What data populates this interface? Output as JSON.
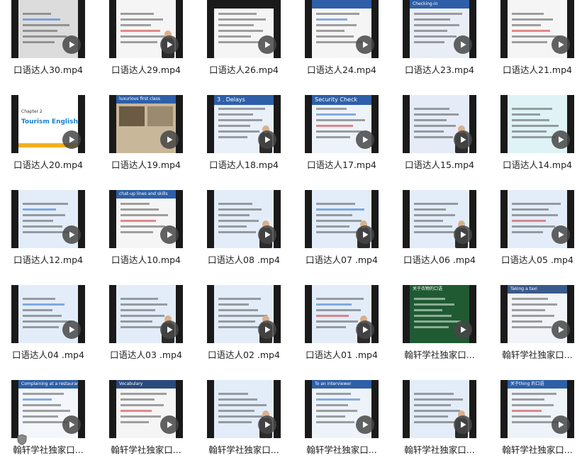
{
  "files": [
    {
      "name": "口语达人30.mp4",
      "theme": "light-gray",
      "accent": "#d9d9d9"
    },
    {
      "name": "口语达人29.mp4",
      "theme": "white",
      "accent": "#e8e8f0"
    },
    {
      "name": "口语达人26.mp4",
      "theme": "white",
      "accent": "#ffffff"
    },
    {
      "name": "口语达人24.mp4",
      "theme": "white",
      "accent": "#ffffff"
    },
    {
      "name": "口语达人23.mp4",
      "theme": "blue",
      "accent": "#2e5fa8"
    },
    {
      "name": "口语达人21.mp4",
      "theme": "white",
      "accent": "#ffffff"
    },
    {
      "name": "口语达人20.mp4",
      "theme": "tourism",
      "accent": "#2a8fd6"
    },
    {
      "name": "口语达人19.mp4",
      "theme": "photo",
      "accent": "#8b7355"
    },
    {
      "name": "口语达人18.mp4",
      "theme": "delays",
      "accent": "#4a7cc7"
    },
    {
      "name": "口语达人17.mp4",
      "theme": "security",
      "accent": "#3a6fb5"
    },
    {
      "name": "口语达人15.mp4",
      "theme": "teacher",
      "accent": "#b9c9e8"
    },
    {
      "name": "口语达人14.mp4",
      "theme": "cyan",
      "accent": "#bfe6ee"
    },
    {
      "name": "口语达人12.mp4",
      "theme": "blue-light",
      "accent": "#cfe0f5"
    },
    {
      "name": "口语达人10.mp4",
      "theme": "white",
      "accent": "#ffffff"
    },
    {
      "name": "口语达人08 .mp4",
      "theme": "blue-light",
      "accent": "#cfe0f5"
    },
    {
      "name": "口语达人07 .mp4",
      "theme": "blue-light",
      "accent": "#cfe0f5"
    },
    {
      "name": "口语达人06 .mp4",
      "theme": "blue-light",
      "accent": "#cfe0f5"
    },
    {
      "name": "口语达人05 .mp4",
      "theme": "blue-light",
      "accent": "#cfe0f5"
    },
    {
      "name": "口语达人04 .mp4",
      "theme": "blue-light",
      "accent": "#cfe0f5"
    },
    {
      "name": "口语达人03 .mp4",
      "theme": "blue-light",
      "accent": "#cfe0f5"
    },
    {
      "name": "口语达人02 .mp4",
      "theme": "blue-light",
      "accent": "#cfe0f5"
    },
    {
      "name": "口语达人01 .mp4",
      "theme": "blue-light",
      "accent": "#cfe0f5"
    },
    {
      "name": "翰轩学社独家口...",
      "theme": "green",
      "accent": "#1f6b3a"
    },
    {
      "name": "翰轩学社独家口...",
      "theme": "taking-taxi",
      "accent": "#dfe7f2"
    },
    {
      "name": "翰轩学社独家口...",
      "theme": "complain",
      "accent": "#3a6fb5"
    },
    {
      "name": "翰轩学社独家口...",
      "theme": "vocab",
      "accent": "#2a4a7c"
    },
    {
      "name": "翰轩学社独家口...",
      "theme": "blue-light",
      "accent": "#cfe0f5"
    },
    {
      "name": "翰轩学社独家口...",
      "theme": "interviewer",
      "accent": "#2a5a9c"
    },
    {
      "name": "翰轩学社独家口...",
      "theme": "blue-light",
      "accent": "#cfe0f5"
    },
    {
      "name": "翰轩学社独家口...",
      "theme": "thing",
      "accent": "#2a5a9c"
    }
  ],
  "thumb_titles": {
    "tourism": "Tourism English",
    "tourism_sub": "Chapter 2",
    "delays": "3 . Delays",
    "security": "Security Check",
    "taking_taxi": "Taking a taxi",
    "complain": "Complaining at a restaurant",
    "vocab": "Vocabulary",
    "interviewer": "To an interviewer",
    "thing": "关于thing 的口语",
    "checking": "Checking-in",
    "photo": "luxurious first class",
    "chatup": "chat-up lines and skills",
    "green": "关于衣物的口语"
  }
}
